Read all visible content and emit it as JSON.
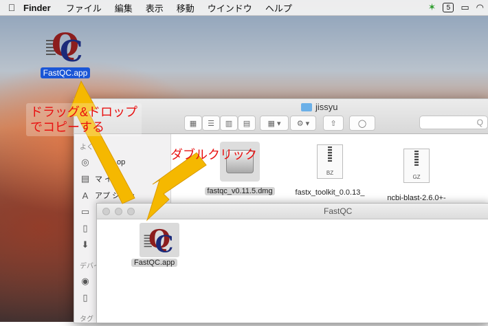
{
  "menubar": {
    "apple": "",
    "app": "Finder",
    "items": [
      "ファイル",
      "編集",
      "表示",
      "移動",
      "ウインドウ",
      "ヘルプ"
    ],
    "status_badge": "5"
  },
  "desktop_icon": {
    "label": "FastQC.app",
    "icon": "fastqc-app-icon"
  },
  "finder_window": {
    "title": "jissyu",
    "search_icon_text": "Q",
    "sidebar": {
      "section1_head": "よく",
      "items": [
        {
          "label": "op",
          "icon": "airdrop-icon"
        },
        {
          "label": "マ  イル",
          "icon": "applications-icon"
        },
        {
          "label": "アプ  ション",
          "icon": "apps-icon"
        },
        {
          "label": "",
          "icon": "desktop-icon"
        },
        {
          "label": "",
          "icon": "documents-icon"
        },
        {
          "label": "",
          "icon": "downloads-icon"
        }
      ],
      "section2_head": "デバイ",
      "section3_head": "タグ"
    },
    "files": [
      {
        "name": "fastqc_v0.11.5.dmg",
        "icon": "dmg-disk-icon"
      },
      {
        "name": "fastx_toolkit_0.0.13_",
        "icon": "archive-icon",
        "ext": "BZ"
      },
      {
        "name": "ncbi-blast-2.6.0+-",
        "icon": "archive-icon",
        "ext": "GZ"
      }
    ]
  },
  "fastqc_window": {
    "title": "FastQC",
    "item": {
      "label": "FastQC.app",
      "icon": "fastqc-app-icon"
    }
  },
  "annotations": {
    "drag_line1": "ドラッグ&ドロップ",
    "drag_line2": "でコピーする",
    "double_click": "ダブルクリック"
  },
  "colors": {
    "annotation_text": "#e81010",
    "arrow": "#f5b800",
    "selection": "#1a56d6"
  }
}
